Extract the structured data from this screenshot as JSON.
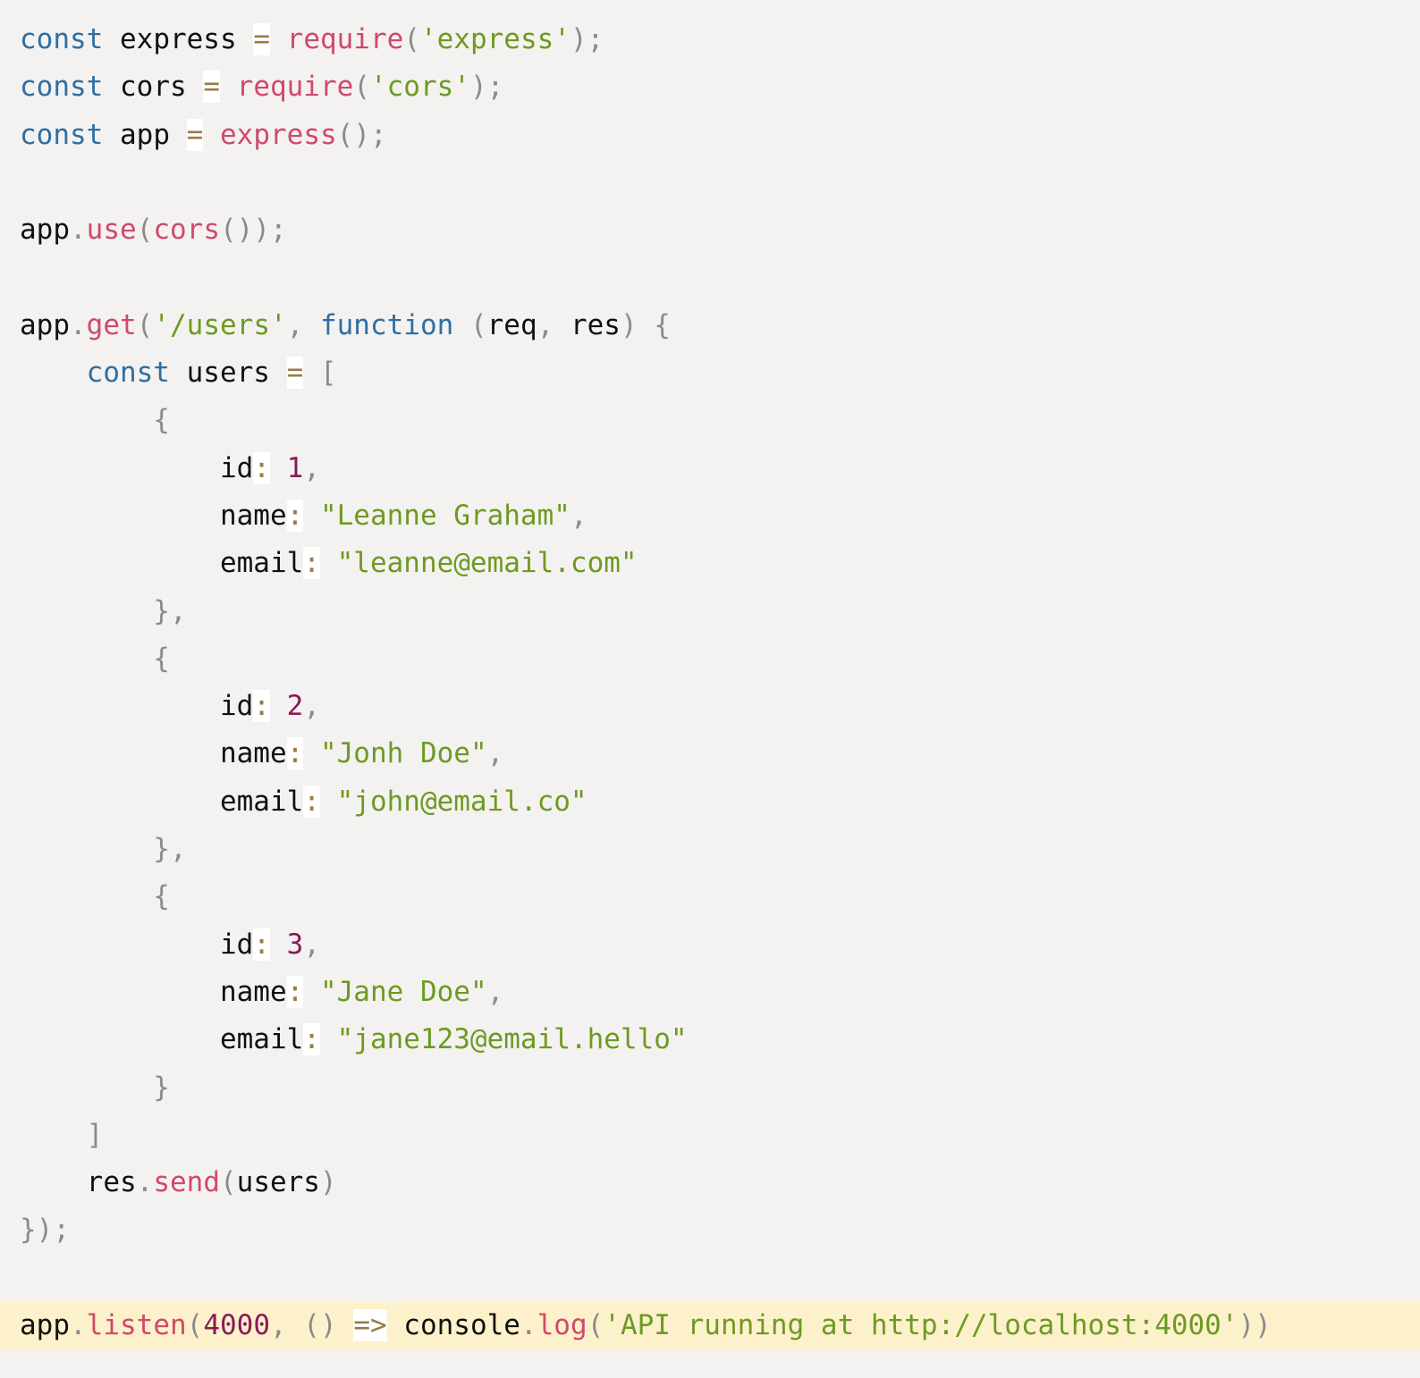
{
  "lines": [
    [
      {
        "t": "kw",
        "v": "const"
      },
      {
        "t": "id",
        "v": " express "
      },
      {
        "t": "op",
        "v": "="
      },
      {
        "t": "id",
        "v": " "
      },
      {
        "t": "fn",
        "v": "require"
      },
      {
        "t": "pn",
        "v": "("
      },
      {
        "t": "str",
        "v": "'express'"
      },
      {
        "t": "pn",
        "v": ");"
      }
    ],
    [
      {
        "t": "kw",
        "v": "const"
      },
      {
        "t": "id",
        "v": " cors "
      },
      {
        "t": "op",
        "v": "="
      },
      {
        "t": "id",
        "v": " "
      },
      {
        "t": "fn",
        "v": "require"
      },
      {
        "t": "pn",
        "v": "("
      },
      {
        "t": "str",
        "v": "'cors'"
      },
      {
        "t": "pn",
        "v": ");"
      }
    ],
    [
      {
        "t": "kw",
        "v": "const"
      },
      {
        "t": "id",
        "v": " app "
      },
      {
        "t": "op",
        "v": "="
      },
      {
        "t": "id",
        "v": " "
      },
      {
        "t": "fn",
        "v": "express"
      },
      {
        "t": "pn",
        "v": "();"
      }
    ],
    [],
    [
      {
        "t": "id",
        "v": "app"
      },
      {
        "t": "pn",
        "v": "."
      },
      {
        "t": "fn",
        "v": "use"
      },
      {
        "t": "pn",
        "v": "("
      },
      {
        "t": "fn",
        "v": "cors"
      },
      {
        "t": "pn",
        "v": "());"
      }
    ],
    [],
    [
      {
        "t": "id",
        "v": "app"
      },
      {
        "t": "pn",
        "v": "."
      },
      {
        "t": "fn",
        "v": "get"
      },
      {
        "t": "pn",
        "v": "("
      },
      {
        "t": "str",
        "v": "'/users'"
      },
      {
        "t": "pn",
        "v": ", "
      },
      {
        "t": "kw",
        "v": "function"
      },
      {
        "t": "id",
        "v": " "
      },
      {
        "t": "pn",
        "v": "("
      },
      {
        "t": "id",
        "v": "req"
      },
      {
        "t": "pn",
        "v": ", "
      },
      {
        "t": "id",
        "v": "res"
      },
      {
        "t": "pn",
        "v": ") {"
      }
    ],
    [
      {
        "t": "id",
        "v": "    "
      },
      {
        "t": "kw",
        "v": "const"
      },
      {
        "t": "id",
        "v": " users "
      },
      {
        "t": "op",
        "v": "="
      },
      {
        "t": "id",
        "v": " "
      },
      {
        "t": "pn",
        "v": "["
      }
    ],
    [
      {
        "t": "pn",
        "v": "        {"
      }
    ],
    [
      {
        "t": "id",
        "v": "            id"
      },
      {
        "t": "op",
        "v": ":"
      },
      {
        "t": "id",
        "v": " "
      },
      {
        "t": "num",
        "v": "1"
      },
      {
        "t": "pn",
        "v": ","
      }
    ],
    [
      {
        "t": "id",
        "v": "            name"
      },
      {
        "t": "op",
        "v": ":"
      },
      {
        "t": "id",
        "v": " "
      },
      {
        "t": "str",
        "v": "\"Leanne Graham\""
      },
      {
        "t": "pn",
        "v": ","
      }
    ],
    [
      {
        "t": "id",
        "v": "            email"
      },
      {
        "t": "op",
        "v": ":"
      },
      {
        "t": "id",
        "v": " "
      },
      {
        "t": "str",
        "v": "\"leanne@email.com\""
      }
    ],
    [
      {
        "t": "pn",
        "v": "        },"
      }
    ],
    [
      {
        "t": "pn",
        "v": "        {"
      }
    ],
    [
      {
        "t": "id",
        "v": "            id"
      },
      {
        "t": "op",
        "v": ":"
      },
      {
        "t": "id",
        "v": " "
      },
      {
        "t": "num",
        "v": "2"
      },
      {
        "t": "pn",
        "v": ","
      }
    ],
    [
      {
        "t": "id",
        "v": "            name"
      },
      {
        "t": "op",
        "v": ":"
      },
      {
        "t": "id",
        "v": " "
      },
      {
        "t": "str",
        "v": "\"Jonh Doe\""
      },
      {
        "t": "pn",
        "v": ","
      }
    ],
    [
      {
        "t": "id",
        "v": "            email"
      },
      {
        "t": "op",
        "v": ":"
      },
      {
        "t": "id",
        "v": " "
      },
      {
        "t": "str",
        "v": "\"john@email.co\""
      }
    ],
    [
      {
        "t": "pn",
        "v": "        },"
      }
    ],
    [
      {
        "t": "pn",
        "v": "        {"
      }
    ],
    [
      {
        "t": "id",
        "v": "            id"
      },
      {
        "t": "op",
        "v": ":"
      },
      {
        "t": "id",
        "v": " "
      },
      {
        "t": "num",
        "v": "3"
      },
      {
        "t": "pn",
        "v": ","
      }
    ],
    [
      {
        "t": "id",
        "v": "            name"
      },
      {
        "t": "op",
        "v": ":"
      },
      {
        "t": "id",
        "v": " "
      },
      {
        "t": "str",
        "v": "\"Jane Doe\""
      },
      {
        "t": "pn",
        "v": ","
      }
    ],
    [
      {
        "t": "id",
        "v": "            email"
      },
      {
        "t": "op",
        "v": ":"
      },
      {
        "t": "id",
        "v": " "
      },
      {
        "t": "str",
        "v": "\"jane123@email.hello\""
      }
    ],
    [
      {
        "t": "pn",
        "v": "        }"
      }
    ],
    [
      {
        "t": "pn",
        "v": "    ]"
      }
    ],
    [
      {
        "t": "id",
        "v": "    res"
      },
      {
        "t": "pn",
        "v": "."
      },
      {
        "t": "fn",
        "v": "send"
      },
      {
        "t": "pn",
        "v": "("
      },
      {
        "t": "id",
        "v": "users"
      },
      {
        "t": "pn",
        "v": ")"
      }
    ],
    [
      {
        "t": "pn",
        "v": "});"
      }
    ],
    [],
    [
      {
        "t": "id",
        "v": "app"
      },
      {
        "t": "pn",
        "v": "."
      },
      {
        "t": "fn",
        "v": "listen"
      },
      {
        "t": "pn",
        "v": "("
      },
      {
        "t": "num",
        "v": "4000"
      },
      {
        "t": "pn",
        "v": ", () "
      },
      {
        "t": "op",
        "v": "=>"
      },
      {
        "t": "id",
        "v": " console"
      },
      {
        "t": "pn",
        "v": "."
      },
      {
        "t": "fn",
        "v": "log"
      },
      {
        "t": "pn",
        "v": "("
      },
      {
        "t": "str",
        "v": "'API running at http://localhost:4000'"
      },
      {
        "t": "pn",
        "v": "))"
      }
    ]
  ],
  "highlighted_line": 27,
  "colors": {
    "background": "#f4f2f0",
    "highlight": "#fdf1cc",
    "keyword": "#2e6fa3",
    "function": "#d0496b",
    "string": "#6d9a22",
    "number": "#8a1a5a",
    "punctuation": "#8b8b8b",
    "operator": "#9a7b46"
  }
}
